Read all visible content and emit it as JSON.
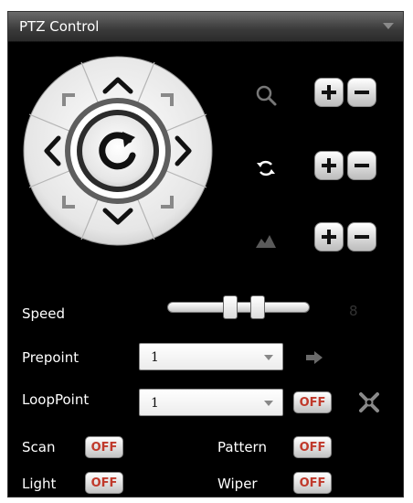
{
  "panel": {
    "title": "PTZ Control"
  },
  "dpad": {
    "up": "arrow-up-icon",
    "down": "arrow-down-icon",
    "left": "arrow-left-icon",
    "right": "arrow-right-icon",
    "center": "auto-rotate-icon"
  },
  "controls": [
    {
      "name": "zoom",
      "icon": "magnifier-icon"
    },
    {
      "name": "focus",
      "icon": "focus-rotate-icon"
    },
    {
      "name": "iris",
      "icon": "iris-mountain-icon"
    }
  ],
  "speed": {
    "label": "Speed",
    "value": "8",
    "level": 0.55
  },
  "prepoint": {
    "label": "Prepoint",
    "selected": "1",
    "go_icon": "arrow-go-icon"
  },
  "looppoint": {
    "label": "LoopPoint",
    "selected": "1",
    "toggle": "OFF",
    "settings_icon": "tools-icon"
  },
  "scan": {
    "label": "Scan",
    "toggle": "OFF"
  },
  "pattern": {
    "label": "Pattern",
    "toggle": "OFF"
  },
  "light": {
    "label": "Light",
    "toggle": "OFF"
  },
  "wiper": {
    "label": "Wiper",
    "toggle": "OFF"
  },
  "colors": {
    "background": "#000000",
    "toggle_text": "#c0392b",
    "title_bar": "#4a4a4a"
  }
}
